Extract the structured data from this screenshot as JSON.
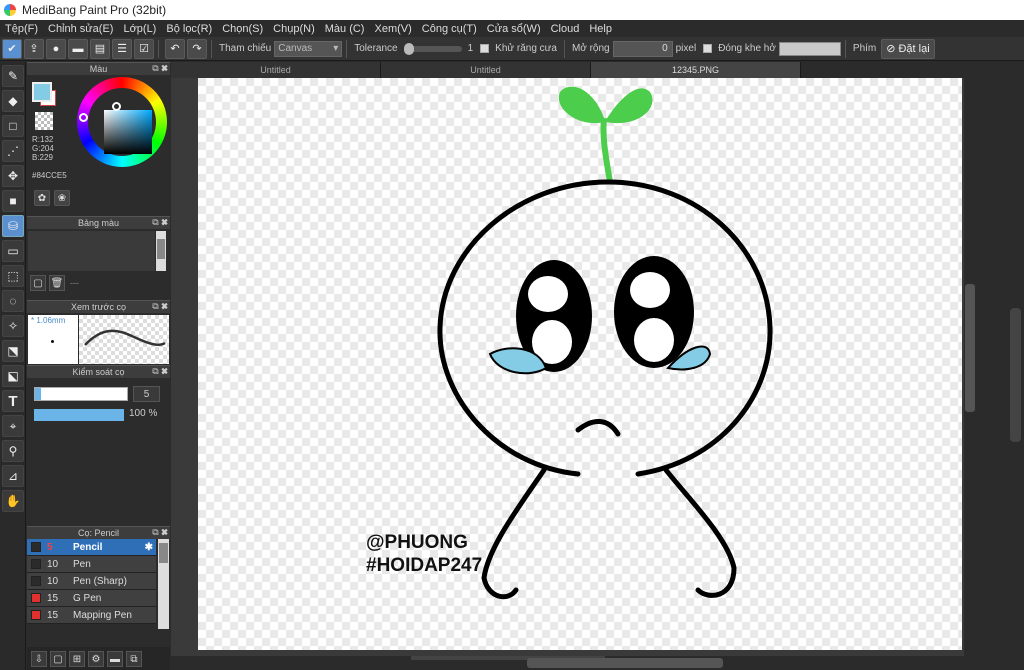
{
  "window": {
    "title": "MediBang Paint Pro (32bit)"
  },
  "menu": [
    "Tệp(F)",
    "Chỉnh sửa(E)",
    "Lớp(L)",
    "Bộ lọc(R)",
    "Chọn(S)",
    "Chụp(N)",
    "Màu (C)",
    "Xem(V)",
    "Công cụ(T)",
    "Cửa sổ(W)",
    "Cloud",
    "Help"
  ],
  "toolbar": {
    "reference_label": "Tham chiếu",
    "reference_value": "Canvas",
    "tolerance_label": "Tolerance",
    "tolerance_value": "1",
    "antialias_label": "Khử răng cưa",
    "expand_label": "Mở rộng",
    "expand_value": "0",
    "expand_unit": "pixel",
    "close_gap_label": "Đóng khe hở",
    "key_label": "Phím",
    "reset_label": "Đặt lại"
  },
  "color_panel": {
    "title": "Màu",
    "r": "R:132",
    "g": "G:204",
    "b": "B:229",
    "hex": "#84CCE5",
    "fg_color": "#84CCE5"
  },
  "palette_panel": {
    "title": "Bảng màu",
    "dash": "---"
  },
  "brush_preview": {
    "title": "Xem trước cọ",
    "size": "* 1.06mm"
  },
  "brush_control": {
    "title": "Kiểm soát cọ",
    "size_value": "5",
    "opacity": "100 %",
    "opacity_fraction": 1.0
  },
  "brush_list": {
    "title": "Cọ: Pencil",
    "items": [
      {
        "num": "5",
        "name": "Pencil",
        "color": "#2f6fb8",
        "selected": true
      },
      {
        "num": "10",
        "name": "Pen",
        "color": "#2b2b2b",
        "selected": false
      },
      {
        "num": "10",
        "name": "Pen (Sharp)",
        "color": "#2b2b2b",
        "selected": false
      },
      {
        "num": "15",
        "name": "G Pen",
        "color": "#e03030",
        "selected": false
      },
      {
        "num": "15",
        "name": "Mapping Pen",
        "color": "#e03030",
        "selected": false
      }
    ]
  },
  "tabs": [
    "Untitled",
    "Untitled",
    "12345.PNG"
  ],
  "canvas": {
    "signature_line1": "@PHUONG",
    "signature_line2": "#HOIDAP247",
    "sprout_color": "#4ccd4c",
    "tear_color": "#84CCE5"
  }
}
